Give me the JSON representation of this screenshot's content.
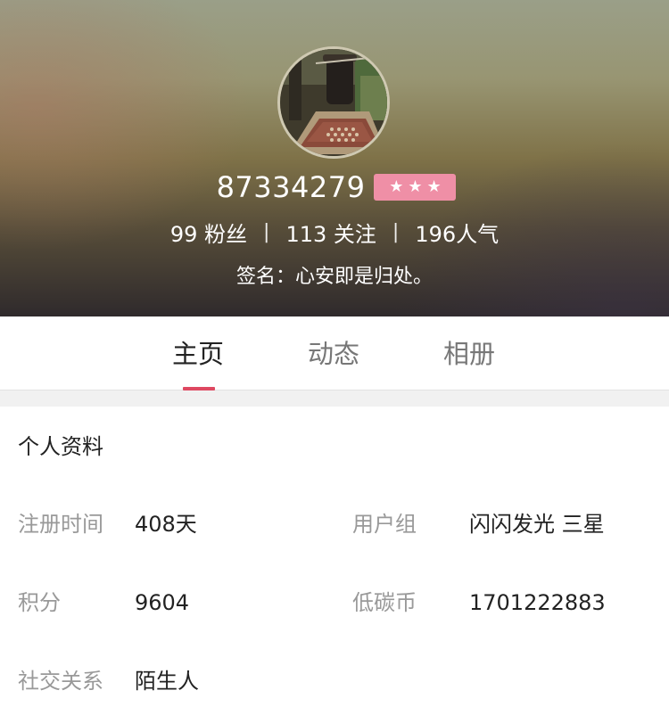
{
  "header": {
    "user_id": "87334279",
    "stars": [
      "★",
      "★",
      "★"
    ],
    "stats": {
      "fans": "99 粉丝",
      "following": "113 关注",
      "popularity": "196人气",
      "separator": "|"
    },
    "signature": "签名：心安即是归处。"
  },
  "tabs": [
    {
      "label": "主页",
      "active": true
    },
    {
      "label": "动态",
      "active": false
    },
    {
      "label": "相册",
      "active": false
    }
  ],
  "profile": {
    "section_title": "个人资料",
    "fields": {
      "register_time": {
        "label": "注册时间",
        "value": "408天"
      },
      "user_group": {
        "label": "用户组",
        "value": "闪闪发光 三星"
      },
      "points": {
        "label": "积分",
        "value": "9604"
      },
      "low_carbon_coin": {
        "label": "低碳币",
        "value": "1701222883"
      },
      "relationship": {
        "label": "社交关系",
        "value": "陌生人"
      }
    }
  },
  "colors": {
    "accent": "#de4861",
    "badge": "#ef8fa6",
    "label_gray": "#999999",
    "text_dark": "#222222"
  }
}
